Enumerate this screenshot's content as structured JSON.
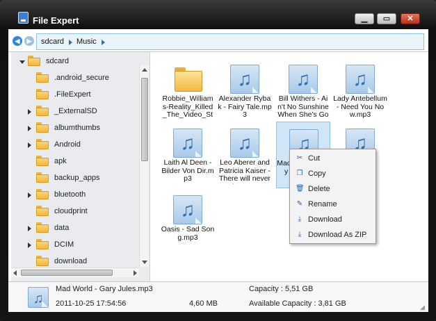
{
  "window": {
    "title": "File Expert"
  },
  "breadcrumb": [
    "sdcard",
    "Music"
  ],
  "tree": [
    {
      "label": "sdcard",
      "expander": "open"
    },
    {
      "label": ".android_secure",
      "expander": "none"
    },
    {
      "label": ".FileExpert",
      "expander": "none"
    },
    {
      "label": "_ExternalSD",
      "expander": "closed"
    },
    {
      "label": "albumthumbs",
      "expander": "closed"
    },
    {
      "label": "Android",
      "expander": "closed"
    },
    {
      "label": "apk",
      "expander": "none"
    },
    {
      "label": "backup_apps",
      "expander": "none"
    },
    {
      "label": "bluetooth",
      "expander": "closed"
    },
    {
      "label": "cloudprint",
      "expander": "none"
    },
    {
      "label": "data",
      "expander": "closed"
    },
    {
      "label": "DCIM",
      "expander": "closed"
    },
    {
      "label": "download",
      "expander": "none"
    }
  ],
  "files": [
    {
      "name": "Robbie_Williams-Reality_Killed_The_Video_Star-PROPER",
      "kind": "folder",
      "selected": false
    },
    {
      "name": "Alexander Rybak - Fairy Tale.mp3",
      "kind": "music",
      "selected": false
    },
    {
      "name": "Bill Withers - Ain't No Sunshine When She's Gone.mp3",
      "kind": "music",
      "selected": false
    },
    {
      "name": "Lady Antebellum - Need You Now.mp3",
      "kind": "music",
      "selected": false
    },
    {
      "name": "Laith Al Deen - Bilder Von Dir.mp3",
      "kind": "music",
      "selected": false
    },
    {
      "name": "Leo Aberer and Patricia Kaiser - There will never be anot",
      "kind": "music",
      "selected": false
    },
    {
      "name": "Mad World - Gary Jules.mp3",
      "kind": "music",
      "selected": true
    },
    {
      "name": "",
      "kind": "music",
      "selected": false
    },
    {
      "name": "Oasis - Sad Song.mp3",
      "kind": "music",
      "selected": false
    }
  ],
  "context_menu": [
    {
      "label": "Cut",
      "icon": "scissors-icon",
      "glyph": "✂"
    },
    {
      "label": "Copy",
      "icon": "copy-icon",
      "glyph": "❐"
    },
    {
      "label": "Delete",
      "icon": "trash-icon",
      "glyph": "🗑"
    },
    {
      "label": "Rename",
      "icon": "pencil-icon",
      "glyph": "✎"
    },
    {
      "label": "Download",
      "icon": "download-icon",
      "glyph": "⤓"
    },
    {
      "label": "Download As ZIP",
      "icon": "download-zip-icon",
      "glyph": "⤓"
    }
  ],
  "status": {
    "filename": "Mad World - Gary Jules.mp3",
    "datetime": "2011-10-25 17:54:56",
    "size": "4,60 MB",
    "capacity": "Capacity : 5,51 GB",
    "available": "Available Capacity : 3,81 GB"
  },
  "colors": {
    "accent": "#2f87d8",
    "selection": "#cfe6f8"
  }
}
